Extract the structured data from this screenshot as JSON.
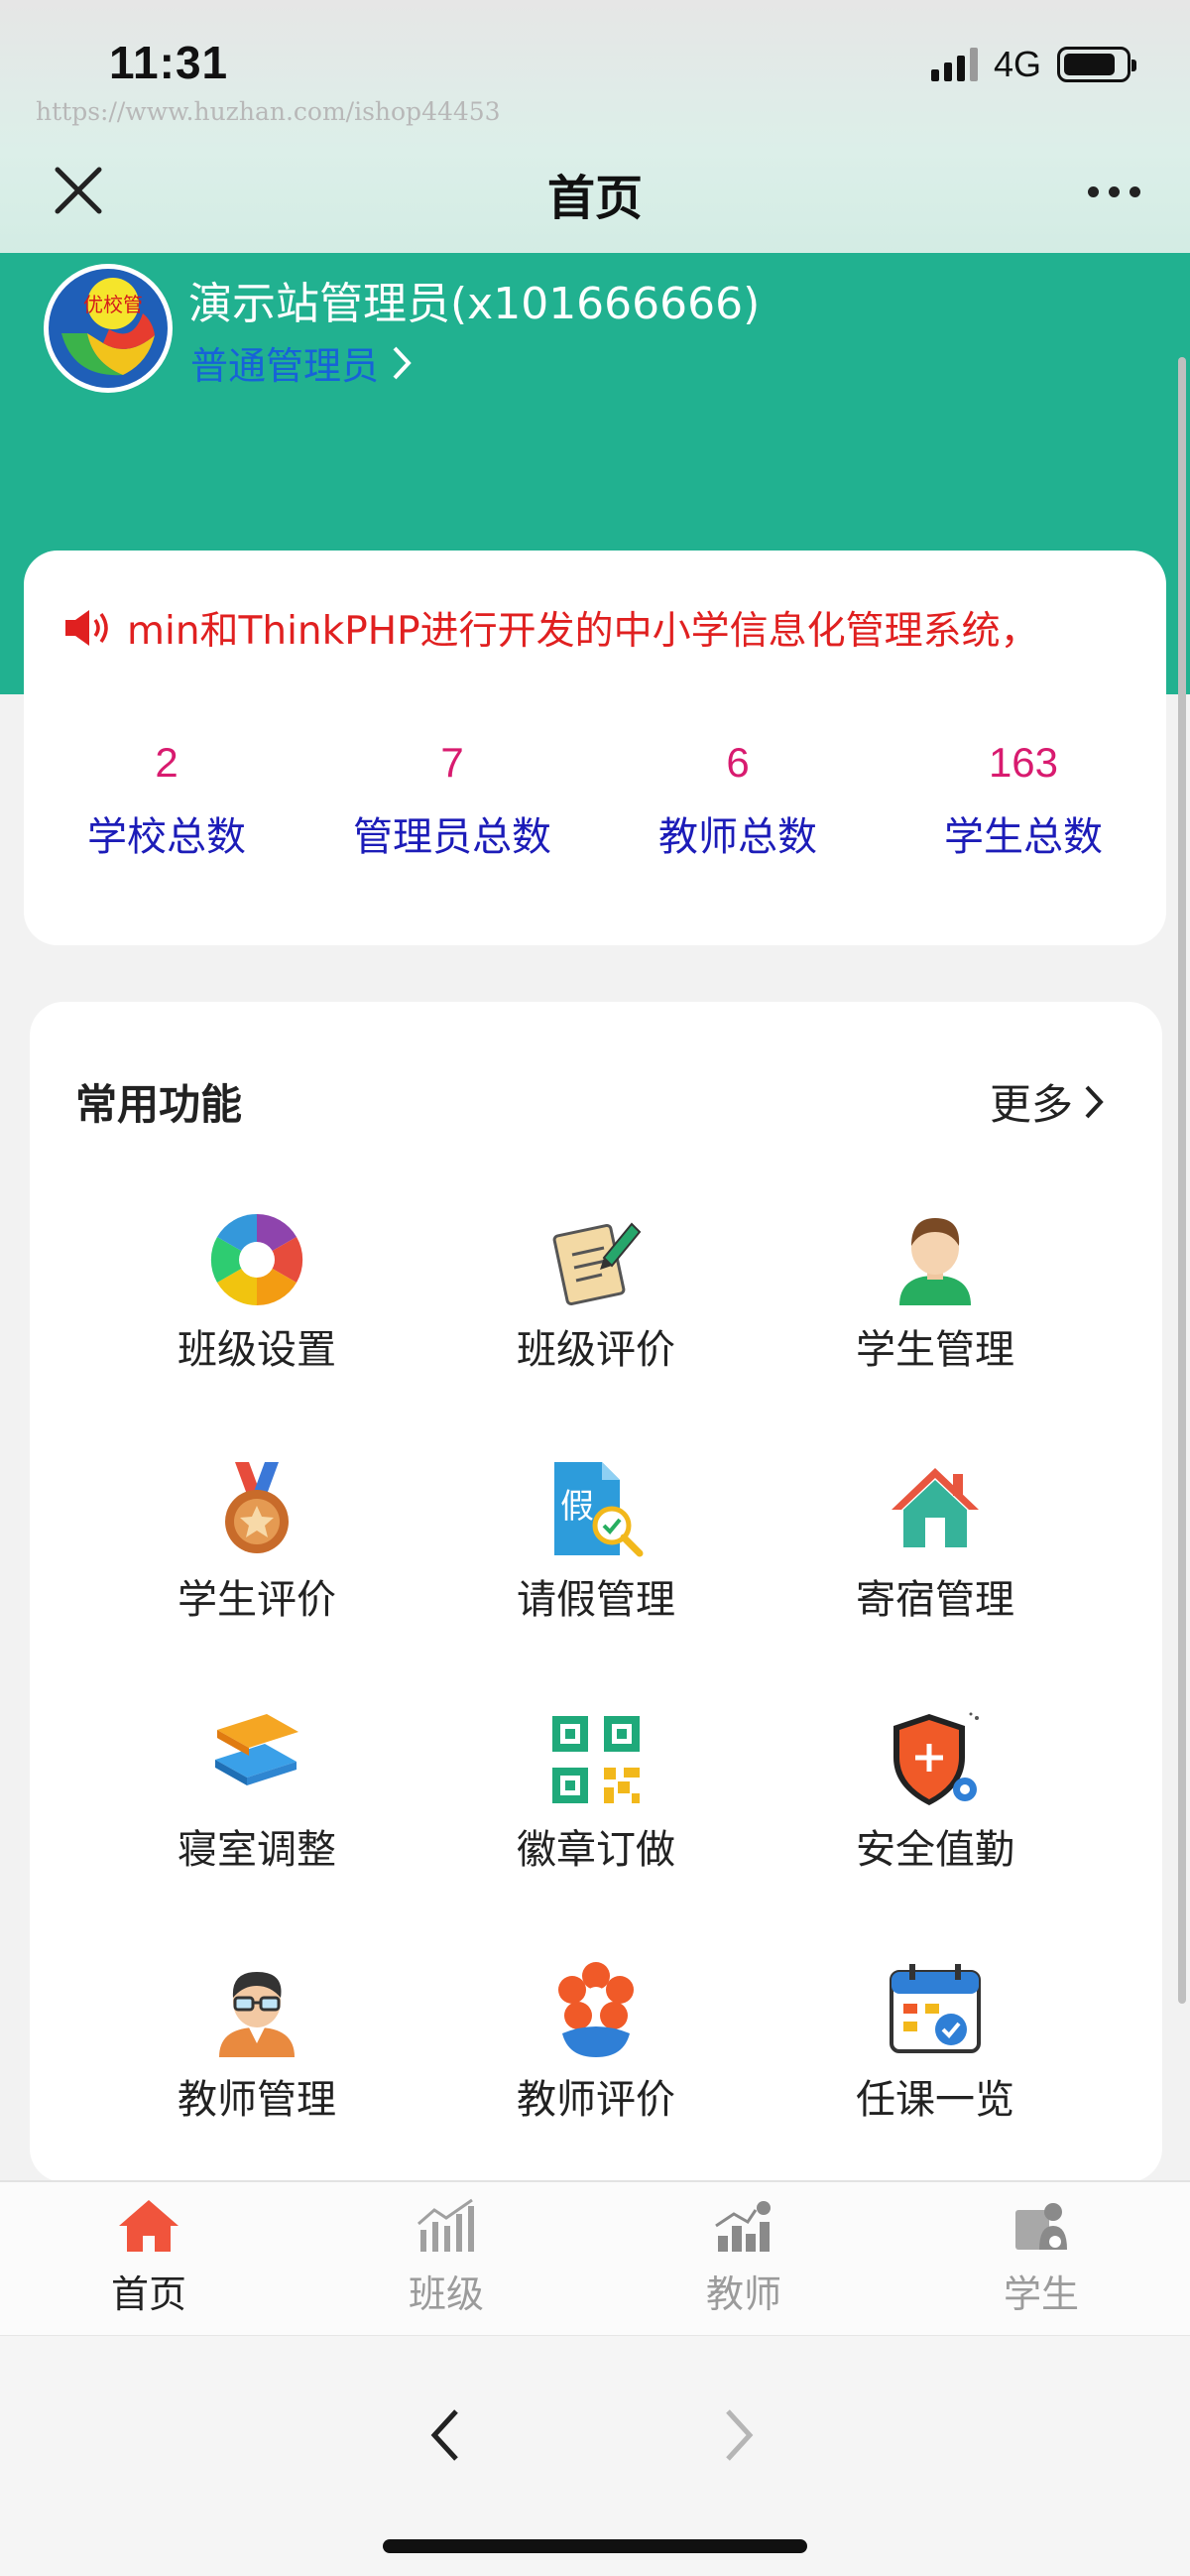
{
  "status_bar": {
    "time": "11:31",
    "network": "4G",
    "battery_level": 0.85
  },
  "watermark": "https://www.huzhan.com/ishop44453",
  "nav": {
    "title": "首页"
  },
  "user": {
    "avatar_text": "优校管",
    "name": "演示站管理员(x101666666)",
    "role": "普通管理员"
  },
  "notice": {
    "text": "min和ThinkPHP进行开发的中小学信息化管理系统，"
  },
  "stats": [
    {
      "value": "2",
      "label": "学校总数"
    },
    {
      "value": "7",
      "label": "管理员总数"
    },
    {
      "value": "6",
      "label": "教师总数"
    },
    {
      "value": "163",
      "label": "学生总数"
    }
  ],
  "functions": {
    "title": "常用功能",
    "more": "更多",
    "items": [
      {
        "label": "班级设置",
        "icon": "aperture-icon"
      },
      {
        "label": "班级评价",
        "icon": "evaluation-notepad-icon"
      },
      {
        "label": "学生管理",
        "icon": "student-avatar-icon"
      },
      {
        "label": "学生评价",
        "icon": "medal-icon"
      },
      {
        "label": "请假管理",
        "icon": "leave-document-icon"
      },
      {
        "label": "寄宿管理",
        "icon": "house-icon"
      },
      {
        "label": "寝室调整",
        "icon": "layers-icon"
      },
      {
        "label": "徽章订做",
        "icon": "qr-code-icon"
      },
      {
        "label": "安全值勤",
        "icon": "shield-icon"
      },
      {
        "label": "教师管理",
        "icon": "teacher-avatar-icon"
      },
      {
        "label": "教师评价",
        "icon": "flower-icon"
      },
      {
        "label": "任课一览",
        "icon": "calendar-check-icon"
      }
    ]
  },
  "tabbar": [
    {
      "label": "首页",
      "icon": "home-icon",
      "active": true
    },
    {
      "label": "班级",
      "icon": "class-chart-icon",
      "active": false
    },
    {
      "label": "教师",
      "icon": "teacher-chart-icon",
      "active": false
    },
    {
      "label": "学生",
      "icon": "student-icon",
      "active": false
    }
  ],
  "colors": {
    "brand_green": "#21b190",
    "notice_red": "#e02020",
    "stat_value": "#d81b6f",
    "stat_label": "#1c1cb8",
    "role_blue": "#1762d8",
    "tab_active": "#f0543c"
  }
}
